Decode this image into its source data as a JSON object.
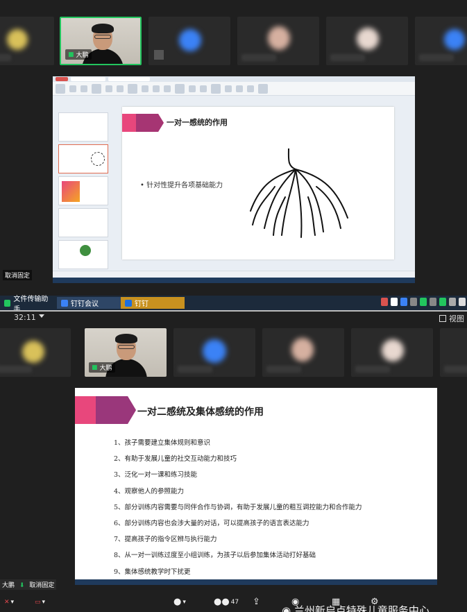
{
  "top_meeting": {
    "presenter_name": "大鹏",
    "unpin_label": "取消固定",
    "slide": {
      "title": "一对一感统的作用",
      "bullet": "针对性提升各项基础能力"
    },
    "taskbar": {
      "items": [
        {
          "label": "文件传输助手",
          "icon": "file-transfer-icon"
        },
        {
          "label": "钉钉会议",
          "icon": "dingtalk-meeting-icon"
        },
        {
          "label": "钉钉",
          "icon": "dingtalk-icon"
        }
      ]
    }
  },
  "bottom_meeting": {
    "elapsed_time": "32:11",
    "view_label": "视图",
    "presenter_name": "大鹏",
    "unpin_label": "取消固定",
    "participant_count": "47",
    "slide": {
      "title": "一对二感统及集体感统的作用",
      "items": [
        "1、孩子需要建立集体规则和意识",
        "2、有助于发展儿童的社交互动能力和技巧",
        "3、泛化一对一课和练习技能",
        "4、观察他人的参照能力",
        "5、部分训练内容需要与同伴合作与协调，有助于发展儿童的粗互调控能力和合作能力",
        "6、部分训练内容也会涉大量的对话，可以提高孩子的语言表达能力",
        "7、提高孩子的指令区辨与执行能力",
        "8、从一对一训练过度至小组训练，为孩子以后参加集体活动打好基础",
        "9、集体感统教学时下扰更"
      ]
    },
    "watermark": "兰州新启点特殊儿童服务中心"
  },
  "colors": {
    "active_speaker": "#22c55e",
    "taskbar": "#1c2a3b",
    "slide_accent": "#c0392b"
  }
}
